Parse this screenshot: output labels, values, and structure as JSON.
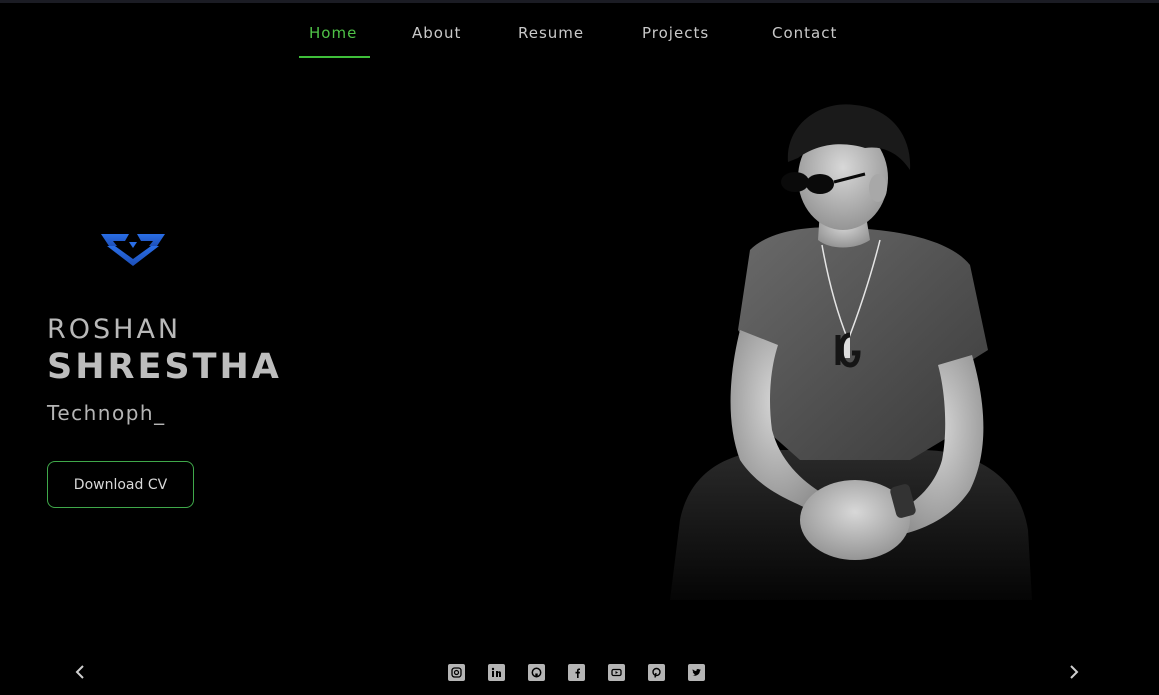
{
  "nav": {
    "items": [
      {
        "label": "Home",
        "active": true
      },
      {
        "label": "About",
        "active": false
      },
      {
        "label": "Resume",
        "active": false
      },
      {
        "label": "Projects",
        "active": false
      },
      {
        "label": "Contact",
        "active": false
      }
    ]
  },
  "hero": {
    "first_name": "ROSHAN",
    "last_name": "SHRESTHA",
    "role": "Technoph_",
    "cta_label": "Download CV"
  },
  "socials": [
    {
      "icon": "instagram-icon"
    },
    {
      "icon": "linkedin-icon"
    },
    {
      "icon": "github-icon"
    },
    {
      "icon": "facebook-icon"
    },
    {
      "icon": "youtube-icon"
    },
    {
      "icon": "pinterest-icon"
    },
    {
      "icon": "twitter-icon"
    }
  ],
  "colors": {
    "accent": "#4fc247",
    "logo": "#2f6de0",
    "background": "#000000"
  }
}
